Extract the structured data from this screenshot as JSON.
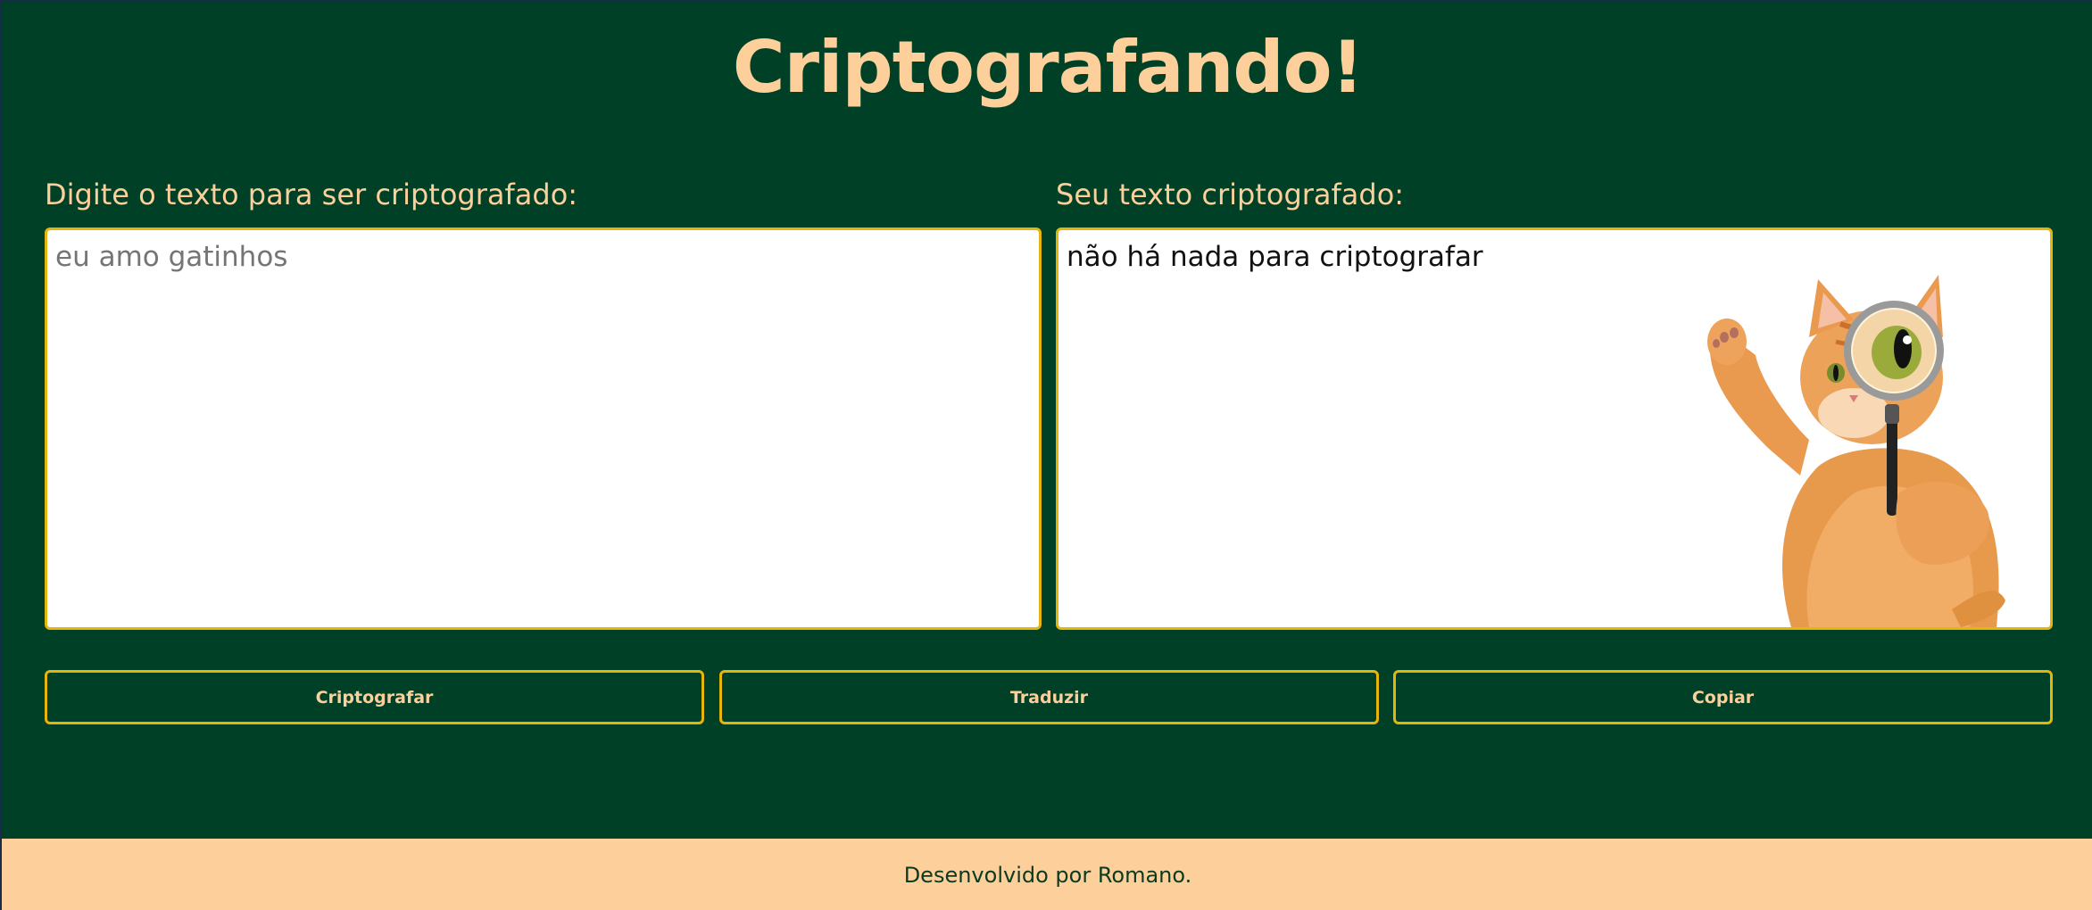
{
  "header": {
    "title": "Criptografando!"
  },
  "input_panel": {
    "label": "Digite o texto para ser criptografado:",
    "placeholder": "eu amo gatinhos",
    "value": ""
  },
  "output_panel": {
    "label": "Seu texto criptografado:",
    "text": "não há nada para criptografar",
    "illustration": "cat-with-magnifying-glass"
  },
  "actions": {
    "encrypt_label": "Criptografar",
    "decrypt_label": "Traduzir",
    "copy_label": "Copiar"
  },
  "footer": {
    "text": "Desenvolvido por Romano."
  },
  "colors": {
    "background": "#004026",
    "accent_text": "#fccf9b",
    "border": "#e5b50e",
    "footer_bg": "#fdcf9b"
  }
}
